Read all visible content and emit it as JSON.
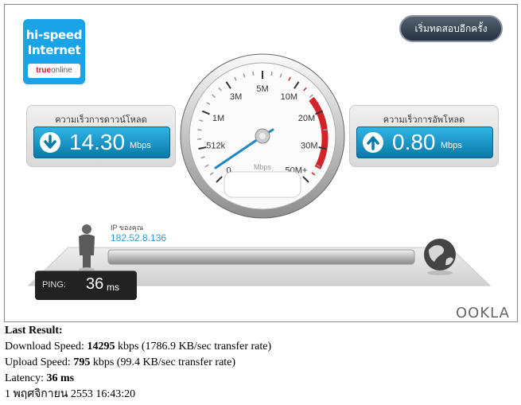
{
  "logo": {
    "line1": "hi-speed",
    "line2": "Internet",
    "brand_bold": "true",
    "brand_rest": "online"
  },
  "restart_label": "เริ่มทดสอบอีกครั้ง",
  "download": {
    "title": "ความเร็วการดาวน์โหลด",
    "value": "14.30",
    "unit": "Mbps"
  },
  "upload": {
    "title": "ความเร็วการอัพโหลด",
    "value": "0.80",
    "unit": "Mbps"
  },
  "gauge": {
    "unit_label": "Mbps",
    "ticks": [
      "0",
      "512k",
      "1M",
      "3M",
      "5M",
      "10M",
      "20M",
      "30M",
      "50M+"
    ]
  },
  "ip": {
    "label": "IP ของคุณ",
    "value": "182.52.8.136"
  },
  "ping": {
    "label": "PING:",
    "value": "36",
    "unit": "ms"
  },
  "ookla": "OOKLA",
  "result": {
    "heading": "Last Result:",
    "download_prefix": "Download Speed: ",
    "download_value": "14295",
    "download_suffix": " kbps (1786.9 KB/sec transfer rate)",
    "upload_prefix": "Upload Speed: ",
    "upload_value": "795",
    "upload_suffix": " kbps (99.4 KB/sec transfer rate)",
    "latency_prefix": "Latency: ",
    "latency_value": "36 ms",
    "timestamp": "1 พฤศจิกายน 2553 16:43:20"
  }
}
